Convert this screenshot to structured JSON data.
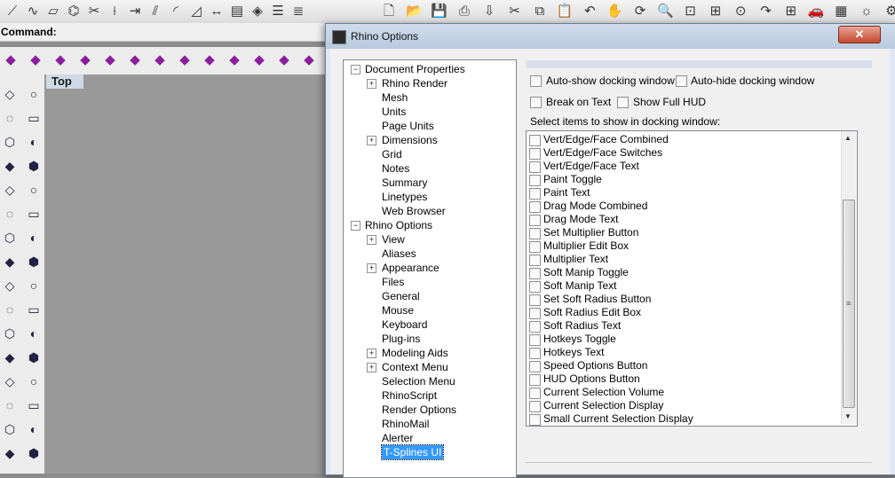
{
  "toolbar_top": {
    "icons": [
      "polyline-icon",
      "curve-icon",
      "surface-icon",
      "rebuild-icon",
      "trim-icon",
      "split-icon",
      "extend-icon",
      "offset-icon",
      "fillet-icon",
      "chamfer-icon",
      "dimension-icon",
      "zebra-icon",
      "render-icon",
      "properties-icon",
      "layers-icon",
      "new-file-icon",
      "open-folder-icon",
      "save-icon",
      "print-icon",
      "import-icon",
      "cut-icon",
      "copy-icon",
      "paste-icon",
      "undo-icon",
      "pan-icon",
      "rotate-view-icon",
      "zoom-icon",
      "zoom-window-icon",
      "zoom-extents-icon",
      "zoom-selected-icon",
      "redo-view-icon",
      "four-viewports-icon",
      "car-icon",
      "grid-plane-icon",
      "sun-icon",
      "settings-icon"
    ]
  },
  "command": {
    "label": "Command:"
  },
  "viewport": {
    "title": "Top"
  },
  "dialog": {
    "title": "Rhino Options",
    "close_glyph": "✕",
    "tree": {
      "items": [
        {
          "label": "Document Properties",
          "level": 0,
          "expander": "−"
        },
        {
          "label": "Rhino Render",
          "level": 1,
          "expander": "+"
        },
        {
          "label": "Mesh",
          "level": 1,
          "expander": ""
        },
        {
          "label": "Units",
          "level": 1,
          "expander": ""
        },
        {
          "label": "Page Units",
          "level": 1,
          "expander": ""
        },
        {
          "label": "Dimensions",
          "level": 1,
          "expander": "+"
        },
        {
          "label": "Grid",
          "level": 1,
          "expander": ""
        },
        {
          "label": "Notes",
          "level": 1,
          "expander": ""
        },
        {
          "label": "Summary",
          "level": 1,
          "expander": ""
        },
        {
          "label": "Linetypes",
          "level": 1,
          "expander": ""
        },
        {
          "label": "Web Browser",
          "level": 1,
          "expander": ""
        },
        {
          "label": "Rhino Options",
          "level": 0,
          "expander": "−"
        },
        {
          "label": "View",
          "level": 1,
          "expander": "+"
        },
        {
          "label": "Aliases",
          "level": 1,
          "expander": ""
        },
        {
          "label": "Appearance",
          "level": 1,
          "expander": "+"
        },
        {
          "label": "Files",
          "level": 1,
          "expander": ""
        },
        {
          "label": "General",
          "level": 1,
          "expander": ""
        },
        {
          "label": "Mouse",
          "level": 1,
          "expander": ""
        },
        {
          "label": "Keyboard",
          "level": 1,
          "expander": ""
        },
        {
          "label": "Plug-ins",
          "level": 1,
          "expander": ""
        },
        {
          "label": "Modeling Aids",
          "level": 1,
          "expander": "+"
        },
        {
          "label": "Context Menu",
          "level": 1,
          "expander": "+"
        },
        {
          "label": "Selection Menu",
          "level": 1,
          "expander": ""
        },
        {
          "label": "RhinoScript",
          "level": 1,
          "expander": ""
        },
        {
          "label": "Render Options",
          "level": 1,
          "expander": ""
        },
        {
          "label": "RhinoMail",
          "level": 1,
          "expander": ""
        },
        {
          "label": "Alerter",
          "level": 1,
          "expander": ""
        },
        {
          "label": "T-Splines UI",
          "level": 1,
          "expander": "",
          "selected": true
        }
      ]
    },
    "options": {
      "auto_show": "Auto-show docking window",
      "auto_hide": "Auto-hide docking window",
      "break_on_text": "Break on Text",
      "show_full_hud": "Show Full HUD",
      "select_label": "Select items to show in docking window:"
    },
    "list_items": [
      "Vert/Edge/Face Combined",
      "Vert/Edge/Face Switches",
      "Vert/Edge/Face Text",
      "Paint Toggle",
      "Paint Text",
      "Drag Mode Combined",
      "Drag Mode Text",
      "Set Multiplier Button",
      "Multiplier Edit Box",
      "Multiplier Text",
      "Soft Manip Toggle",
      "Soft Manip Text",
      "Set Soft Radius Button",
      "Soft Radius Edit Box",
      "Soft Radius Text",
      "Hotkeys Toggle",
      "Hotkeys Text",
      "Speed Options Button",
      "HUD Options Button",
      "Current Selection Volume",
      "Current Selection Display",
      "Small Current Selection Display"
    ],
    "scroll": {
      "up_glyph": "▲",
      "down_glyph": "▼",
      "grip_glyph": "≡"
    }
  }
}
